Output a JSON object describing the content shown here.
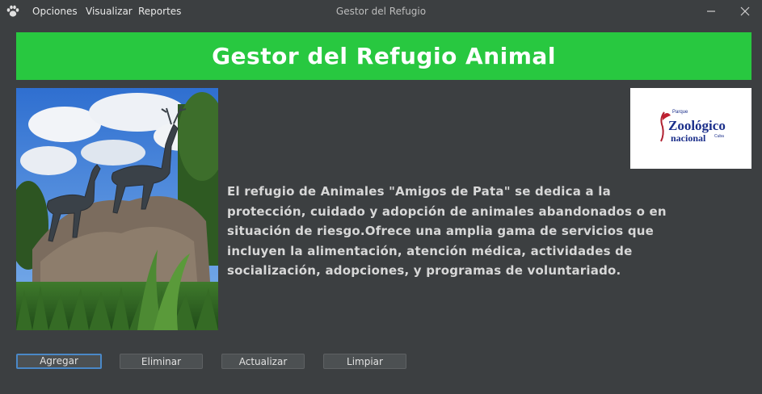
{
  "window": {
    "title": "Gestor del Refugio"
  },
  "menu": {
    "items": [
      "Opciones",
      "Visualizar",
      "Reportes"
    ]
  },
  "banner": {
    "title": "Gestor del Refugio Animal",
    "color": "#28c840"
  },
  "description": "El refugio de Animales \"Amigos de Pata\" se dedica a la protección, cuidado y adopción de animales abandonados o en situación de riesgo.Ofrece una amplia gama de servicios que incluyen la alimentación, atención médica, actividades de socialización, adopciones, y programas de voluntariado.",
  "logo": {
    "line1": "Parque",
    "line2": "Zoológico",
    "line3": "nacional",
    "line4": "Cuba"
  },
  "buttons": {
    "add": "Agregar",
    "delete": "Eliminar",
    "update": "Actualizar",
    "clear": "Limpiar"
  }
}
